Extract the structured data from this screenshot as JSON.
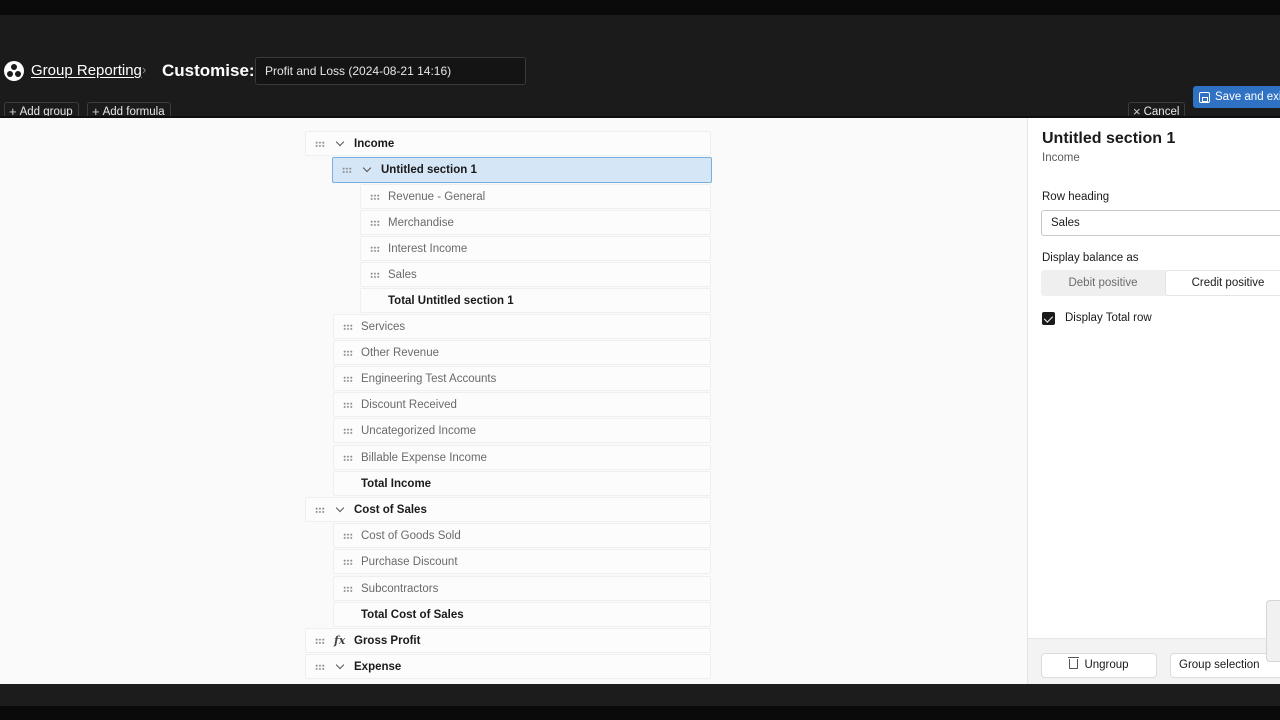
{
  "header": {
    "breadcrumb_link": "Group Reporting",
    "breadcrumb_sep": "›",
    "page_title": "Customise:",
    "report_name": "Profit and Loss (2024-08-21 14:16)"
  },
  "toolbar": {
    "add_group": "Add group",
    "add_formula": "Add formula",
    "cancel": "Cancel",
    "save_and_exit": "Save and exit"
  },
  "icons": {
    "plus": "+",
    "close": "×"
  },
  "tree": {
    "income": "Income",
    "untitled_section": "Untitled section 1",
    "revenue_general": "Revenue - General",
    "merchandise": "Merchandise",
    "interest_income": "Interest Income",
    "sales": "Sales",
    "total_untitled": "Total Untitled section 1",
    "services": "Services",
    "other_revenue": "Other Revenue",
    "engineering_test": "Engineering Test Accounts",
    "discount_received": "Discount Received",
    "uncategorized_income": "Uncategorized Income",
    "billable_expense_income": "Billable Expense Income",
    "total_income": "Total Income",
    "cost_of_sales": "Cost of Sales",
    "cost_of_goods_sold": "Cost of Goods Sold",
    "purchase_discount": "Purchase Discount",
    "subcontractors": "Subcontractors",
    "total_cost_of_sales": "Total Cost of Sales",
    "gross_profit": "Gross Profit",
    "expense": "Expense",
    "fx_symbol": "fx"
  },
  "panel": {
    "title": "Untitled section 1",
    "subtitle": "Income",
    "row_heading_label": "Row heading",
    "row_heading_value": "Sales",
    "display_balance_label": "Display balance as",
    "debit_positive": "Debit positive",
    "credit_positive": "Credit positive",
    "display_total_label": "Display Total row",
    "display_total_checked": true,
    "ungroup": "Ungroup",
    "group_selection": "Group selection"
  },
  "colors": {
    "accent": "#2f72c4",
    "selected_row": "#d5e6f7",
    "header_bg": "#1b1b1b"
  }
}
